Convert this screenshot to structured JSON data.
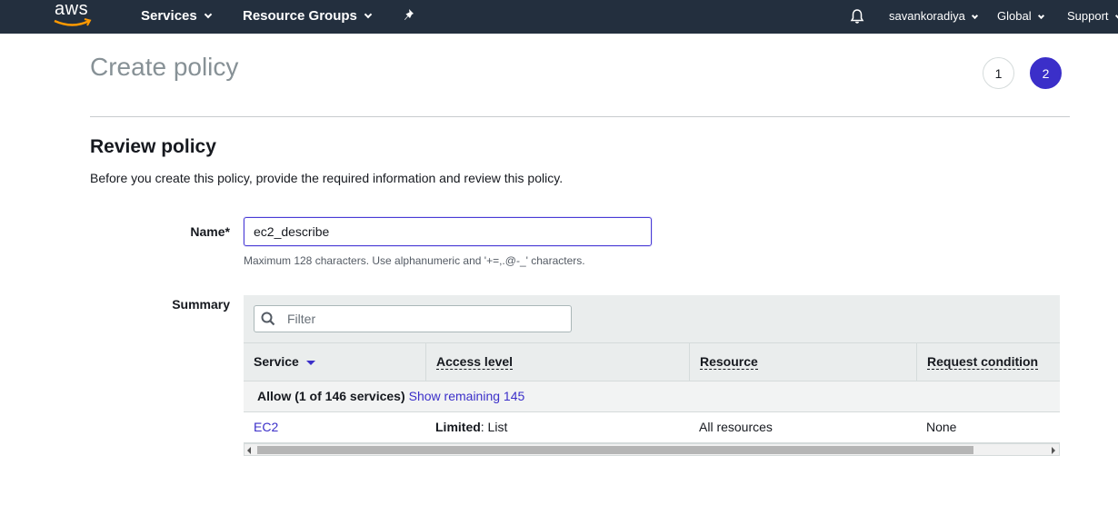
{
  "nav": {
    "logo_text": "aws",
    "services": "Services",
    "resource_groups": "Resource Groups",
    "username": "savankoradiya",
    "region": "Global",
    "support": "Support"
  },
  "page": {
    "title": "Create policy",
    "steps": [
      "1",
      "2"
    ],
    "active_step": "2"
  },
  "review": {
    "title": "Review policy",
    "description": "Before you create this policy, provide the required information and review this policy.",
    "name_label": "Name*",
    "name_value": "ec2_describe",
    "name_hint": "Maximum 128 characters. Use alphanumeric and '+=,.@-_' characters.",
    "summary_label": "Summary"
  },
  "summary": {
    "filter_placeholder": "Filter",
    "columns": {
      "service": "Service",
      "access_level": "Access level",
      "resource": "Resource",
      "request_condition": "Request condition"
    },
    "group": {
      "label": "Allow (1 of 146 services)",
      "link": "Show remaining 145"
    },
    "rows": [
      {
        "service": "EC2",
        "access_level_prefix": "Limited",
        "access_level_suffix": ": List",
        "resource": "All resources",
        "request_condition": "None"
      }
    ]
  },
  "colors": {
    "nav_bg": "#232f3e",
    "accent": "#3b2fc9",
    "title_gray": "#879196"
  }
}
